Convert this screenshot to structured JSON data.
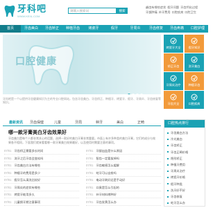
{
  "header": {
    "logo_text": "牙科吧",
    "logo_url": "WWW.KEIIL.COM",
    "search_placeholder": "请输入搜索词",
    "search_button": "搜索",
    "hot_links": [
      "龋齿有哪些症状",
      "假牙问题",
      "牙齿钙化过程",
      "牙龈肿痛",
      "补牙费用",
      "口腔疾病",
      "口腔卫生"
    ],
    "brand_color": "#1aa2b4"
  },
  "nav": {
    "items": [
      "首页",
      "牙齿美白",
      "牙齿矫正",
      "种植牙齿",
      "烤瓷牙",
      "假牙",
      "牙周炎",
      "牙齿修复",
      "牙齿疼痛",
      "口腔护理"
    ],
    "active_index": 0
  },
  "banner": {
    "text": "口腔健康",
    "slides": 4,
    "current_slide": 1
  },
  "tiles": [
    {
      "label": "烤瓷牙大全",
      "icon": "tooth-icon",
      "color": "#1aa2b4"
    },
    {
      "label": "假牙知识",
      "icon": "denture-icon",
      "color": "#f29a3a"
    },
    {
      "label": "矫正牙齿",
      "icon": "brace-icon",
      "color": "#f29a3a"
    },
    {
      "label": "洗牙美白",
      "icon": "sparkle-icon",
      "color": "#1aa2b4"
    },
    {
      "label": "牙周炎治疗",
      "icon": "gum-icon",
      "color": "#1aa2b4"
    },
    {
      "label": "种植牙齿",
      "icon": "implant-icon",
      "color": "#f29a3a"
    },
    {
      "label": "牙齿大全",
      "icon": "book-icon",
      "color": "#f29a3a"
    },
    {
      "label": "口腔疾病",
      "icon": "mouth-icon",
      "color": "#1aa2b4"
    }
  ],
  "intro": "牙科吧是一个以提供牙齿健康知识为主的专业口腔网站，包含牙齿美白、牙齿矫正、种植牙、烤瓷牙、假牙、牙周炎、牙齿修复等知识。",
  "tabs": {
    "items": [
      "最新资讯",
      "牙齿保健",
      "儿童",
      "牙周",
      "种牙",
      "美白",
      "正畸"
    ],
    "active_index": 0
  },
  "featured": {
    "title": "哪一款牙膏美白牙齿效果好",
    "desc": "牙齿美白是每个人都非常关心的话题，选择一款好的美白牙膏非常重要。市面上有许多种类的美白牙膏，它们的成分与效果各不相同，下面我们就来看看哪一款牙膏美白效果最好，以及使用时需要注意的事项。"
  },
  "news_left": [
    {
      "date": "07/01",
      "title": "牙齿矫正需要多长时间"
    },
    {
      "date": "07/01",
      "title": "洗牙之后牙齿会变松吗"
    },
    {
      "date": "07/01",
      "title": "牙齿美白方法有哪些"
    },
    {
      "date": "07/01",
      "title": "种植牙的费用是多少"
    },
    {
      "date": "07/01",
      "title": "假牙怎么清洗比较好"
    },
    {
      "date": "07/01",
      "title": "牙周炎的症状有哪些"
    },
    {
      "date": "07/01",
      "title": "烤瓷牙能用多久"
    },
    {
      "date": "07/01",
      "title": "儿童换牙期注意事项"
    }
  ],
  "news_right": [
    {
      "date": "07/01",
      "title": "牙龈出血是什么原因"
    },
    {
      "date": "07/01",
      "title": "智齿一定要拔掉吗"
    },
    {
      "date": "07/01",
      "title": "牙齿敏感怎么缓解"
    },
    {
      "date": "07/01",
      "title": "蛀牙可以自愈吗"
    },
    {
      "date": "07/01",
      "title": "电动牙刷好还是手动好"
    },
    {
      "date": "07/01",
      "title": "口臭是怎么引起的"
    },
    {
      "date": "07/01",
      "title": "补牙材料哪种好"
    },
    {
      "date": "07/01",
      "title": "牙齿发黄怎么办"
    }
  ],
  "rank": {
    "title": "口腔热点排行",
    "items": [
      "牙齿美白方法",
      "冷光美白",
      "牙齿矫正",
      "牙齿正畸价格",
      "隐形矫正",
      "种植牙费用",
      "牙周炎治疗",
      "烤瓷牙价格",
      "假牙种类",
      "洗牙好不好",
      "牙齿修复",
      "蛀牙怎么办"
    ]
  }
}
